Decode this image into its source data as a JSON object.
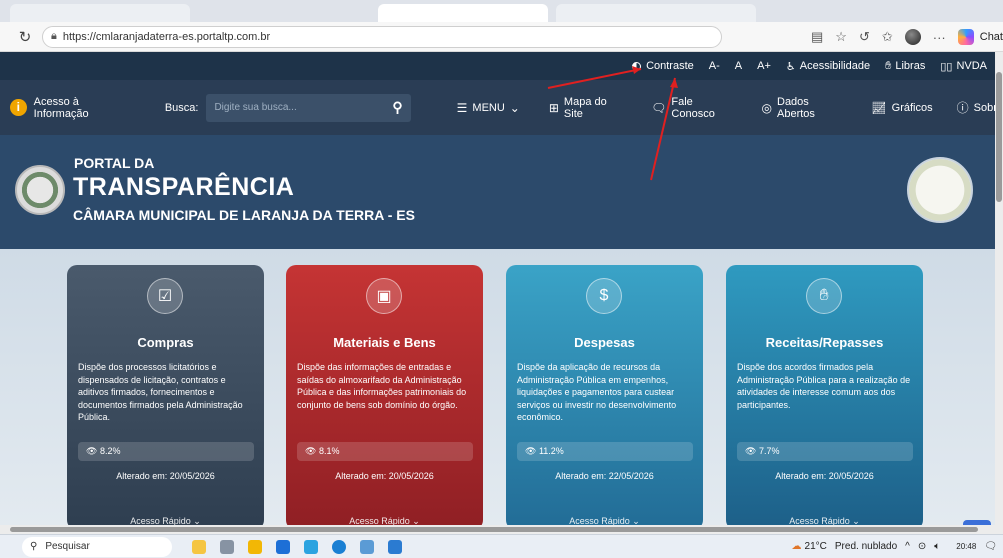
{
  "browser": {
    "url": "https://cmlaranjadaterra-es.portaltp.com.br",
    "chat_label": "Chat"
  },
  "topbar": {
    "contraste": "Contraste",
    "font_smaller": "A-",
    "font_normal": "A",
    "font_bigger": "A+",
    "acessibilidade": "Acessibilidade",
    "libras": "Libras",
    "nvda": "NVDA"
  },
  "navbar": {
    "acesso": "Acesso à Informação",
    "busca_label": "Busca:",
    "search_placeholder": "Digite sua busca...",
    "menu": "MENU",
    "mapa": "Mapa do Site",
    "fale": "Fale Conosco",
    "dados": "Dados Abertos",
    "graficos": "Gráficos",
    "sobre": "Sobre"
  },
  "hero": {
    "line1": "PORTAL DA",
    "line2": "TRANSPARÊNCIA",
    "line3": "CÂMARA MUNICIPAL DE LARANJA DA TERRA - ES"
  },
  "cards": [
    {
      "title": "Compras",
      "desc": "Dispõe dos processos licitatórios e dispensados de licitação, contratos e aditivos firmados, fornecimentos e documentos firmados pela Administração Pública.",
      "stat": "8.2%",
      "date": "Alterado em: 20/05/2026",
      "quick": "Acesso Rápido"
    },
    {
      "title": "Materiais e Bens",
      "desc": "Dispõe das informações de entradas e saídas do almoxarifado da Administração Pública e das informações patrimoniais do conjunto de bens sob domínio do órgão.",
      "stat": "8.1%",
      "date": "Alterado em: 20/05/2026",
      "quick": "Acesso Rápido"
    },
    {
      "title": "Despesas",
      "desc": "Dispõe da aplicação de recursos da Administração Pública em empenhos, liquidações e pagamentos para custear serviços ou investir no desenvolvimento econômico.",
      "stat": "11.2%",
      "date": "Alterado em: 22/05/2026",
      "quick": "Acesso Rápido"
    },
    {
      "title": "Receitas/Repasses",
      "desc": "Dispõe dos acordos firmados pela Administração Pública para a realização de atividades de interesse comum aos dos participantes.",
      "stat": "7.7%",
      "date": "Alterado em: 20/05/2026",
      "quick": "Acesso Rápido"
    }
  ],
  "taskbar": {
    "search": "Pesquisar",
    "weather": "21°C",
    "weather_desc": "Pred. nublado",
    "time": "20:48"
  }
}
